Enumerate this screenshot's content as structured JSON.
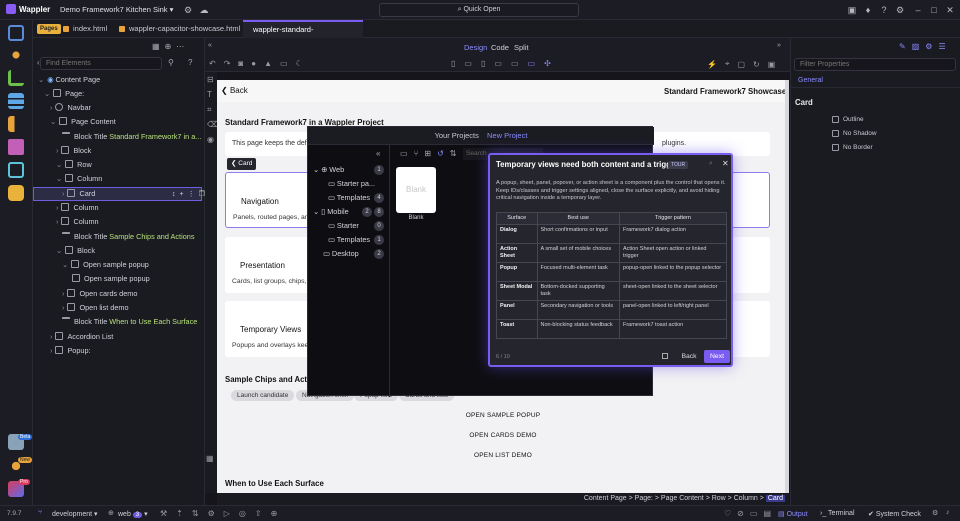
{
  "app": {
    "name": "Wappler",
    "project": "Demo Framework7 Kitchen Sink",
    "quick_open": "Quick Open"
  },
  "tabs": {
    "pages_label": "Pages",
    "items": [
      {
        "label": "index.html"
      },
      {
        "label": "wappler-capacitor-showcase.html"
      },
      {
        "label": "wappler-standard-showcase.html"
      }
    ],
    "close": "×"
  },
  "tree": {
    "search_placeholder": "Find Elements",
    "nodes": [
      {
        "label": "Content Page"
      },
      {
        "label": "Page:"
      },
      {
        "label": "Navbar"
      },
      {
        "label": "Page Content"
      },
      {
        "label": "Block Title",
        "hl": "Standard Framework7 in a..."
      },
      {
        "label": "Block"
      },
      {
        "label": "Row"
      },
      {
        "label": "Column"
      },
      {
        "label": "Card"
      },
      {
        "label": "Column"
      },
      {
        "label": "Column"
      },
      {
        "label": "Block Title",
        "hl": "Sample Chips and Actions"
      },
      {
        "label": "Block"
      },
      {
        "label": "Open sample popup"
      },
      {
        "label": "Open sample popup"
      },
      {
        "label": "Open cards demo"
      },
      {
        "label": "Open list demo"
      },
      {
        "label": "Block Title",
        "hl": "When to Use Each Surface"
      },
      {
        "label": "Accordion List"
      },
      {
        "label": "Popup:"
      }
    ]
  },
  "design": {
    "modes": [
      "Design",
      "Code",
      "Split"
    ]
  },
  "canvas": {
    "back": "Back",
    "nav_title": "Standard Framework7 Showcase",
    "section_title": "Standard Framework7 in a Wappler Project",
    "intro": "This page keeps the defau",
    "intro_tail": "plugins.",
    "card_tag": "Card",
    "blocks": [
      {
        "title": "Navigation",
        "text": "Panels, routed pages, and"
      },
      {
        "title": "Presentation",
        "text": "Cards, list groups, chips, a"
      },
      {
        "title": "Temporary Views",
        "text": "Popups and overlays keep"
      }
    ],
    "chips_title": "Sample Chips and Actio",
    "chips": [
      "Launch candidate",
      "Navigation shell",
      "Popup flow",
      "Cards and lists"
    ],
    "links": [
      "OPEN SAMPLE POPUP",
      "OPEN CARDS DEMO",
      "OPEN LIST DEMO"
    ],
    "when_title": "When to Use Each Surface"
  },
  "breadcrumb": {
    "text": "Content Page > Page: > Page Content > Row > Column > ",
    "current": "Card"
  },
  "right": {
    "filter_placeholder": "Filter Properties",
    "tab": "General",
    "section": "Card",
    "options": [
      "Outline",
      "No Shadow",
      "No Border"
    ]
  },
  "projects": {
    "title": "Your Projects",
    "new": "New Project",
    "search_placeholder": "Search",
    "items": [
      {
        "label": "Web",
        "count": "1"
      },
      {
        "label": "Starter pa...",
        "count": ""
      },
      {
        "label": "Templates",
        "count": "4"
      },
      {
        "label": "Mobile",
        "count": "8"
      },
      {
        "label": "Starter",
        "count": "0"
      },
      {
        "label": "Templates",
        "count": "1"
      },
      {
        "label": "Desktop",
        "count": "2"
      }
    ],
    "mobile_pre": "2",
    "tile_text": "Blank",
    "tile_label": "Blank"
  },
  "tour": {
    "title": "Temporary views need both content and a trigger",
    "badge": "TOUR",
    "desc": "A popup, sheet, panel, popover, or action sheet is a component plus the control that opens it. Keep IDs/classes and trigger settings aligned, close the surface explicitly, and avoid hiding critical navigation inside a temporary layer.",
    "headers": [
      "Surface",
      "Best use",
      "Trigger pattern"
    ],
    "rows": [
      [
        "Dialog",
        "Short confirmations or input",
        "Framework7 dialog action"
      ],
      [
        "Action Sheet",
        "A small set of mobile choices",
        "Action Sheet open action or linked trigger"
      ],
      [
        "Popup",
        "Focused multi-element task",
        "popup-open linked to the popup selector"
      ],
      [
        "Sheet Modal",
        "Bottom-docked supporting task",
        "sheet-open linked to the sheet selector"
      ],
      [
        "Panel",
        "Secondary navigation or tools",
        "panel-open linked to left/right panel"
      ],
      [
        "Toast",
        "Non-blocking status feedback",
        "Framework7 toast action"
      ]
    ],
    "progress": "6 / 10",
    "back": "Back",
    "next": "Next"
  },
  "status": {
    "version": "7.9.7",
    "env": "development",
    "target": "web",
    "target_count": "3",
    "output": "Output",
    "terminal": "Terminal",
    "system_check": "System Check"
  },
  "rail_badges": {
    "beta": "Beta",
    "new": "New",
    "pro": "Pro"
  },
  "colors": {
    "accent": "#7a5cf0",
    "link": "#8b8bff",
    "highlight": "#b7e27a",
    "tab_marker": "#e8a33a"
  }
}
